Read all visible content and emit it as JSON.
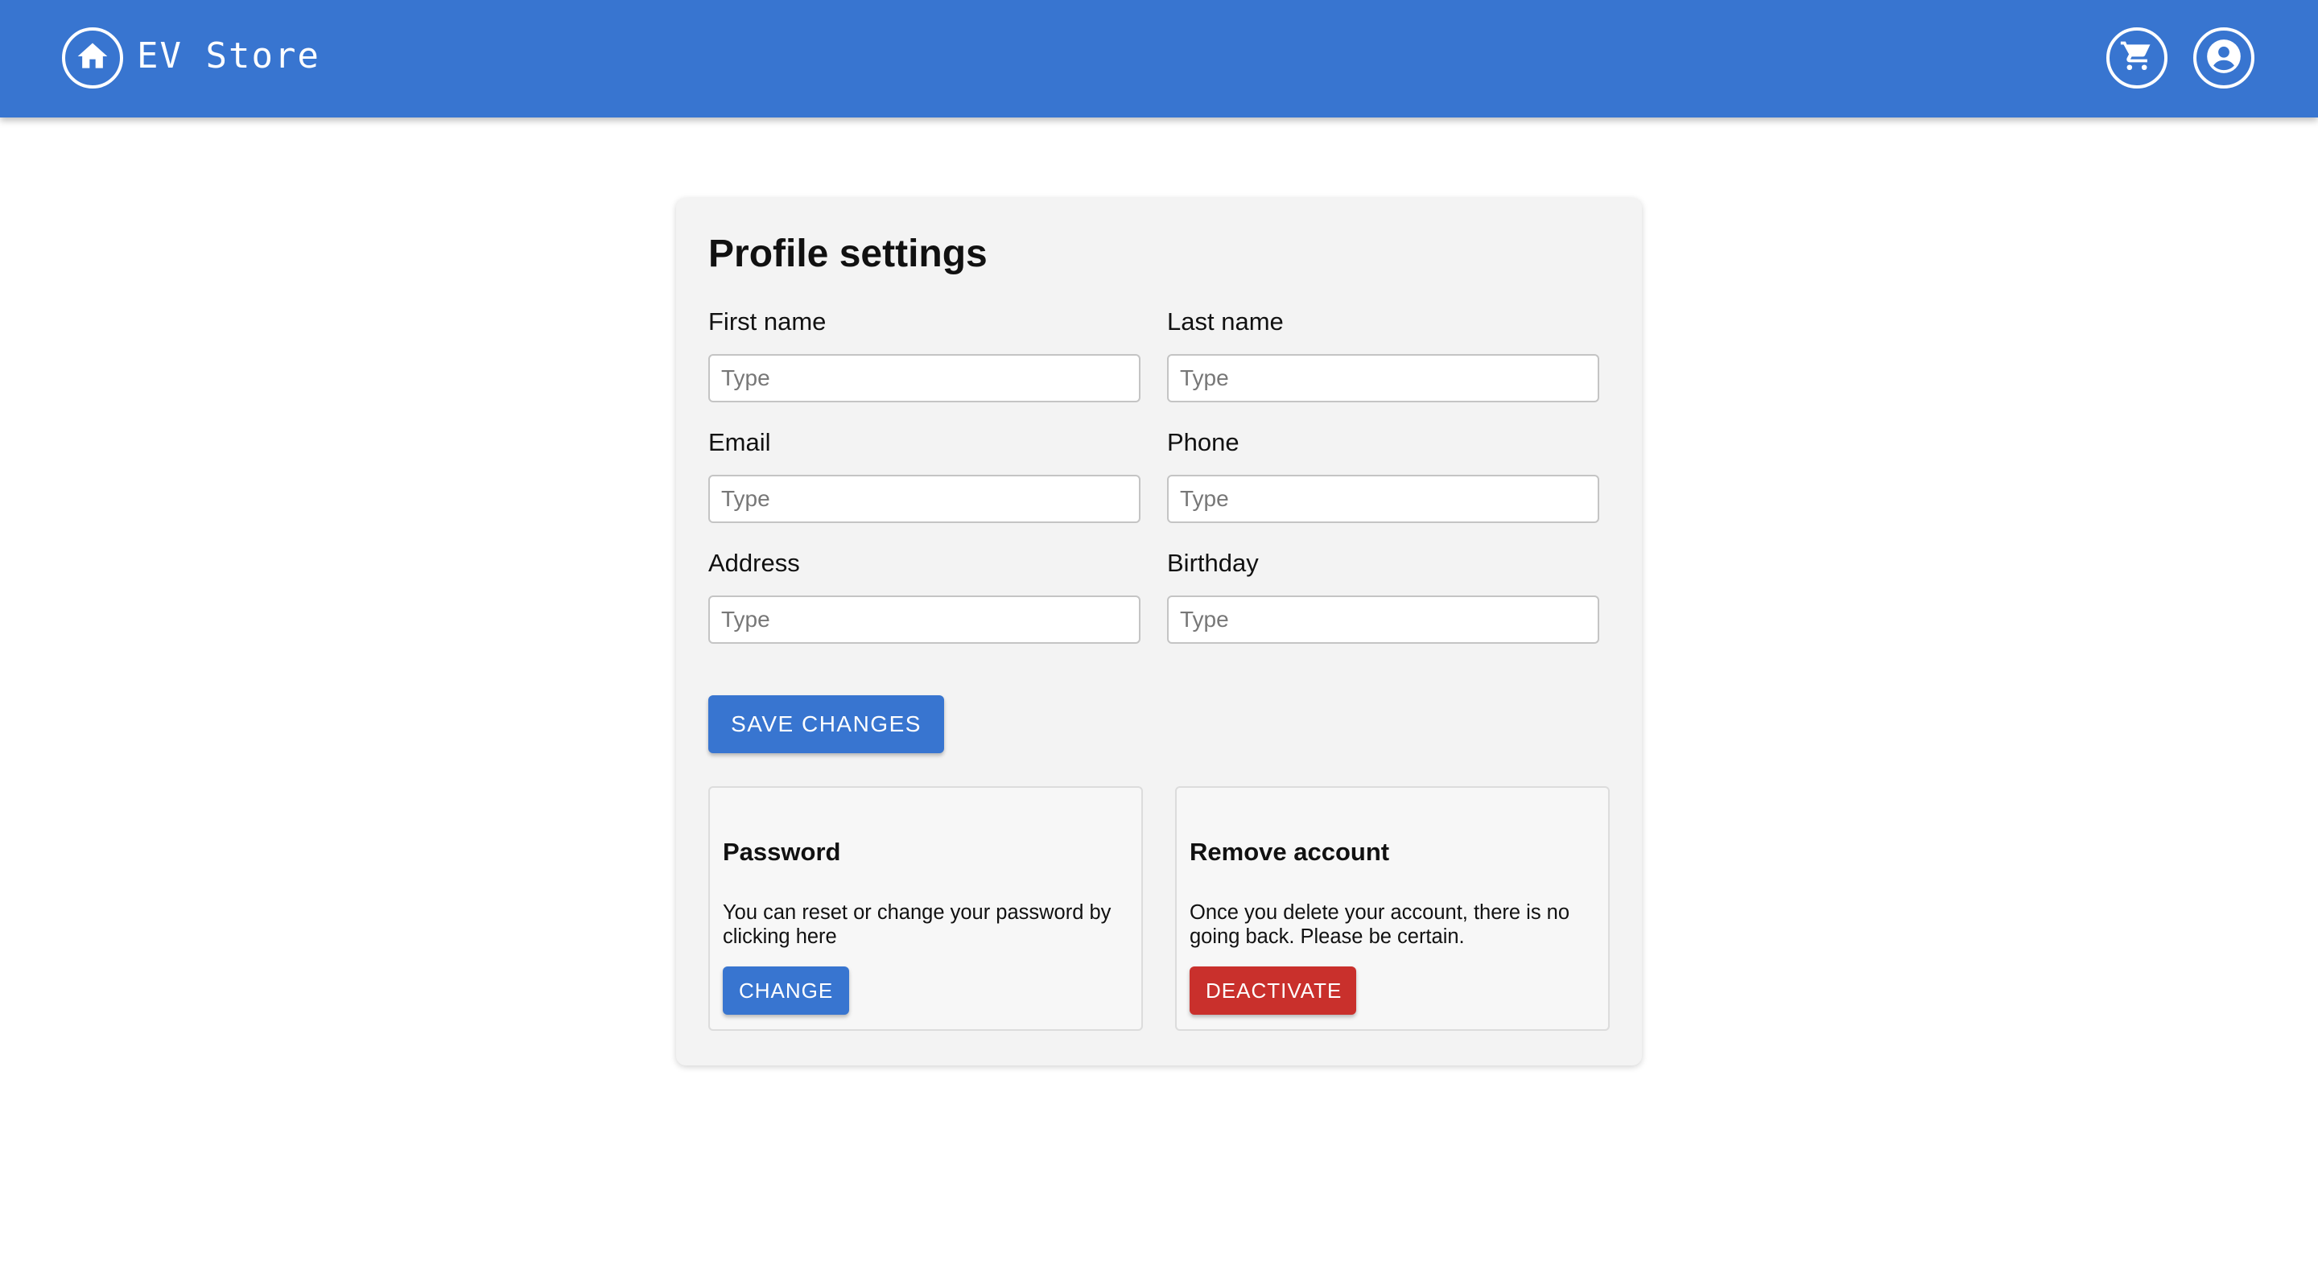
{
  "header": {
    "brand": "EV Store",
    "icons": [
      "home-icon",
      "cart-icon",
      "account-icon"
    ]
  },
  "profile": {
    "title": "Profile settings",
    "fields": {
      "first_name": {
        "label": "First name",
        "placeholder": "Type",
        "value": ""
      },
      "last_name": {
        "label": "Last name",
        "placeholder": "Type",
        "value": ""
      },
      "email": {
        "label": "Email",
        "placeholder": "Type",
        "value": ""
      },
      "phone": {
        "label": "Phone",
        "placeholder": "Type",
        "value": ""
      },
      "address": {
        "label": "Address",
        "placeholder": "Type",
        "value": ""
      },
      "birthday": {
        "label": "Birthday",
        "placeholder": "Type",
        "value": ""
      }
    },
    "save_label": "SAVE CHANGES"
  },
  "password_card": {
    "title": "Password",
    "text": "You can reset or change your password by clicking here",
    "button": "CHANGE"
  },
  "remove_card": {
    "title": "Remove account",
    "text": "Once you delete your account, there is no going back. Please be certain.",
    "button": "DEACTIVATE"
  },
  "colors": {
    "primary": "#3875d0",
    "danger": "#c9302c",
    "card_bg": "#f3f3f3"
  }
}
